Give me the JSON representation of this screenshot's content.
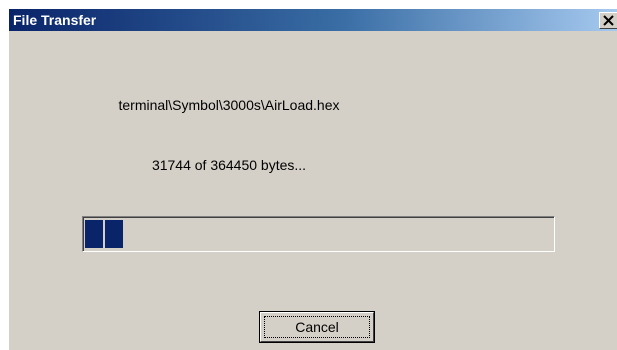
{
  "window": {
    "title": "File Transfer",
    "close_icon": "close-icon"
  },
  "transfer": {
    "filename": "terminal\\Symbol\\3000s\\AirLoad.hex",
    "status": "31744 of 364450 bytes...",
    "bytes_done": 31744,
    "bytes_total": 364450,
    "progress_fraction": 0.087
  },
  "buttons": {
    "cancel_label": "Cancel"
  },
  "colors": {
    "titlebar_start": "#0a246a",
    "titlebar_end": "#a6caf0",
    "progress_fill": "#0a246a",
    "dialog_face": "#d4d0c8"
  }
}
